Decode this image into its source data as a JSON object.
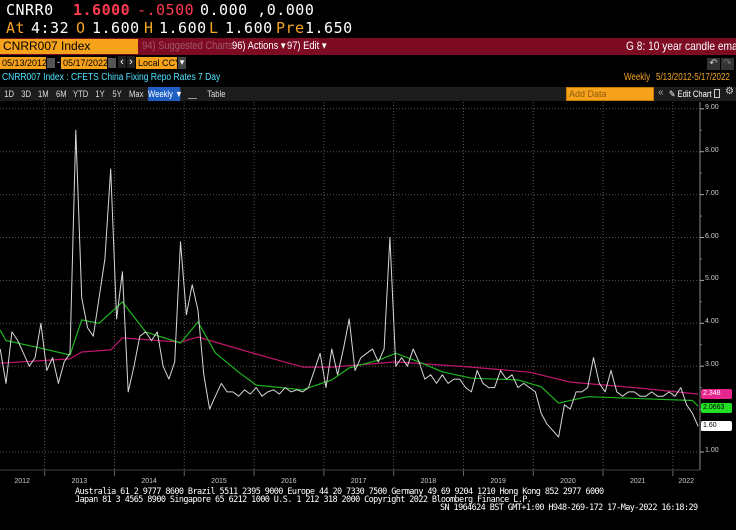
{
  "quote": {
    "ticker": "CNRR0",
    "last": "1.6000",
    "change": "-.0500",
    "bid_ask": "0.000 ,0.000",
    "at_label": "At",
    "time": "4:32",
    "open_label": "O",
    "open": "1.600",
    "high_label": "H",
    "high": "1.600",
    "low_label": "L",
    "low": "1.600",
    "prev_label": "Pre",
    "prev": "1.650"
  },
  "command": {
    "security": "CNRR007 Index",
    "suggested": "94) Suggested Charts",
    "actions": "96) Actions ▾",
    "edit": "97) Edit ▾",
    "page_title": "G 8: 10 year candle ema"
  },
  "range": {
    "start": "05/13/2012",
    "end": "05/17/2022",
    "dash": "-",
    "prev": "‹",
    "next": "›",
    "currency": "Local CCY",
    "dropdown": "▾"
  },
  "chart_title": "CNRR007 Index : CFETS China Fixing Repo Rates 7 Day",
  "period": {
    "frequency": "Weekly",
    "span": "5/13/2012-5/17/2022"
  },
  "toolbar": {
    "buttons": [
      "1D",
      "3D",
      "1M",
      "6M",
      "YTD",
      "1Y",
      "5Y",
      "Max"
    ],
    "frequency": "Weekly ▼",
    "table": "Table",
    "add_data_placeholder": "Add Data",
    "collapse": "«",
    "edit_chart": "✎ Edit Chart",
    "undo": "↶",
    "redo": "↷"
  },
  "icons": [
    "calendar-icon",
    "chart-type-icon",
    "undo-icon",
    "redo-icon",
    "legend-icon",
    "gear-icon",
    "pencil-icon"
  ],
  "colors": {
    "price": "#d8d8d8",
    "ema_short": "#1fb51f",
    "ema_long": "#c0176e",
    "accent": "#f7a21b",
    "header_bar": "#7d0b24",
    "title": "#4fe3ff"
  },
  "chart_data": {
    "type": "line",
    "ylim": [
      1.0,
      9.0
    ],
    "yticks": [
      "1.00",
      "2.00",
      "3.00",
      "4.00",
      "5.00",
      "6.00",
      "7.00",
      "8.00",
      "9.00"
    ],
    "xticks": [
      "2012",
      "2013",
      "2014",
      "2015",
      "2016",
      "2017",
      "2018",
      "2019",
      "2020",
      "2021",
      "2022"
    ],
    "grid": true,
    "series": [
      {
        "start": "2012-05",
        "frequency": "monthly",
        "color": "#d8d8d8",
        "last_tag": "1.60",
        "values": [
          3.4,
          2.6,
          3.8,
          3.6,
          3.3,
          3.0,
          3.2,
          4.0,
          2.9,
          3.2,
          2.6,
          3.1,
          3.3,
          8.5,
          4.6,
          3.9,
          3.7,
          4.6,
          5.5,
          7.6,
          4.1,
          5.2,
          2.4,
          3.0,
          3.7,
          3.8,
          3.6,
          3.8,
          3.0,
          2.7,
          3.1,
          5.9,
          4.2,
          4.9,
          4.3,
          2.8,
          2.0,
          2.3,
          2.6,
          2.4,
          2.4,
          2.3,
          2.45,
          2.35,
          2.5,
          2.3,
          2.4,
          2.45,
          2.35,
          2.5,
          2.4,
          2.45,
          2.4,
          2.5,
          2.9,
          3.3,
          2.5,
          3.4,
          2.8,
          3.4,
          4.1,
          2.9,
          3.2,
          3.3,
          3.4,
          3.1,
          3.4,
          6.0,
          3.0,
          3.2,
          3.0,
          3.4,
          3.1,
          2.7,
          2.8,
          2.6,
          2.8,
          2.6,
          2.7,
          2.7,
          2.5,
          2.4,
          2.9,
          2.6,
          2.5,
          2.5,
          2.9,
          2.7,
          2.8,
          2.5,
          2.6,
          2.5,
          2.4,
          1.9,
          1.65,
          1.5,
          1.35,
          2.1,
          2.0,
          2.4,
          2.4,
          2.5,
          3.2,
          2.6,
          2.4,
          2.9,
          2.4,
          2.3,
          2.4,
          2.4,
          2.3,
          2.3,
          2.4,
          2.3,
          2.3,
          2.4,
          2.3,
          2.5,
          2.1,
          1.9,
          1.6
        ]
      },
      {
        "color": "#1fb51f",
        "last_tag": "2.0663",
        "points": [
          [
            "2012-05",
            3.84
          ],
          [
            "2012-06",
            3.6
          ],
          [
            "2012-12",
            3.42
          ],
          [
            "2013-05",
            3.26
          ],
          [
            "2013-07",
            4.08
          ],
          [
            "2013-10",
            4.0
          ],
          [
            "2014-02",
            4.5
          ],
          [
            "2014-06",
            3.8
          ],
          [
            "2014-12",
            3.54
          ],
          [
            "2015-03",
            4.03
          ],
          [
            "2015-06",
            3.31
          ],
          [
            "2015-10",
            2.86
          ],
          [
            "2016-01",
            2.56
          ],
          [
            "2016-09",
            2.45
          ],
          [
            "2017-02",
            2.68
          ],
          [
            "2017-05",
            2.96
          ],
          [
            "2017-10",
            3.14
          ],
          [
            "2018-01",
            3.3
          ],
          [
            "2018-05",
            3.1
          ],
          [
            "2018-09",
            2.87
          ],
          [
            "2019-02",
            2.72
          ],
          [
            "2019-10",
            2.68
          ],
          [
            "2020-02",
            2.52
          ],
          [
            "2020-05",
            2.14
          ],
          [
            "2020-10",
            2.29
          ],
          [
            "2022-04",
            2.2
          ],
          [
            "2022-05",
            2.07
          ]
        ]
      },
      {
        "color": "#c0176e",
        "last_tag": "2.348",
        "points": [
          [
            "2012-05",
            3.07
          ],
          [
            "2013-05",
            3.17
          ],
          [
            "2013-07",
            3.33
          ],
          [
            "2013-12",
            3.38
          ],
          [
            "2014-02",
            3.66
          ],
          [
            "2014-12",
            3.56
          ],
          [
            "2015-03",
            3.68
          ],
          [
            "2015-10",
            3.4
          ],
          [
            "2016-09",
            2.98
          ],
          [
            "2017-02",
            2.98
          ],
          [
            "2018-01",
            3.1
          ],
          [
            "2019-02",
            2.98
          ],
          [
            "2019-12",
            2.86
          ],
          [
            "2020-07",
            2.63
          ],
          [
            "2021-07",
            2.49
          ],
          [
            "2022-05",
            2.35
          ]
        ]
      }
    ]
  },
  "footer": {
    "line1": "Australia 61 2 9777 8600 Brazil 5511 2395 9000 Europe 44 20 7330 7500 Germany 49 69 9204 1210 Hong Kong 852 2977 6000",
    "line2": "Japan 81 3 4565 8900       Singapore 65 6212 1000       U.S. 1 212 318 2000          Copyright 2022 Bloomberg Finance L.P.",
    "line3": "SN 1964624 BST  GMT+1:00 H948-269-172 17-May-2022 16:18:29"
  }
}
